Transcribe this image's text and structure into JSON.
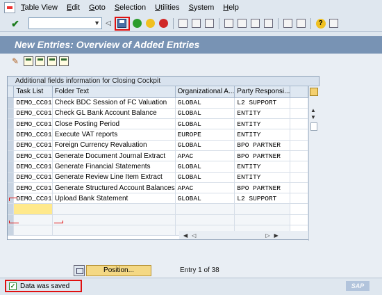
{
  "menu": {
    "items": [
      {
        "label": "Table View",
        "underline": "T",
        "rest": "able View"
      },
      {
        "label": "Edit",
        "underline": "E",
        "rest": "dit"
      },
      {
        "label": "Goto",
        "underline": "G",
        "rest": "oto"
      },
      {
        "label": "Selection",
        "underline": "S",
        "rest": "election"
      },
      {
        "label": "Utilities",
        "underline": "U",
        "rest": "tilities"
      },
      {
        "label": "System",
        "underline": "S",
        "rest": "ystem"
      },
      {
        "label": "Help",
        "underline": "H",
        "rest": "elp"
      }
    ]
  },
  "toolbar": {
    "command_field_value": "",
    "icons": [
      "enter-icon",
      "save-icon",
      "back-icon",
      "exit-icon",
      "cancel-icon",
      "print-icon",
      "find-icon",
      "find-next-icon",
      "first-page-icon",
      "previous-page-icon",
      "next-page-icon",
      "last-page-icon",
      "create-session-icon",
      "shortcut-icon",
      "help-icon",
      "layout-icon"
    ]
  },
  "title": "New Entries: Overview of Added Entries",
  "app_toolbar": {
    "icons": [
      "display-change-icon",
      "new-entries-icon",
      "copy-as-icon",
      "delete-icon",
      "undo-change-icon"
    ]
  },
  "table": {
    "title": "Additional fields information for Closing Cockpit",
    "columns": [
      "Task List",
      "Folder Text",
      "Organizational A...",
      "Party Responsi..."
    ],
    "rows": [
      [
        "DEMO_CC01",
        "Check BDC Session of FC Valuation",
        "GLOBAL",
        "L2 SUPPORT"
      ],
      [
        "DEMO_CC01",
        "Check GL Bank Account Balance",
        "GLOBAL",
        "ENTITY"
      ],
      [
        "DEMO_CC01",
        "Close Posting Period",
        "GLOBAL",
        "ENTITY"
      ],
      [
        "DEMO_CC01",
        "Execute VAT reports",
        "EUROPE",
        "ENTITY"
      ],
      [
        "DEMO_CC01",
        "Foreign Currency Revaluation",
        "GLOBAL",
        "BPO PARTNER"
      ],
      [
        "DEMO_CC01",
        "Generate Document Journal Extract",
        "APAC",
        "BPO PARTNER"
      ],
      [
        "DEMO_CC01",
        "Generate Financial Statements",
        "GLOBAL",
        "ENTITY"
      ],
      [
        "DEMO_CC01",
        "Generate Review Line Item Extract",
        "GLOBAL",
        "ENTITY"
      ],
      [
        "DEMO_CC01",
        "Generate Structured Account Balances",
        "APAC",
        "BPO PARTNER"
      ],
      [
        "DEMO_CC01",
        "Upload Bank Statement",
        "GLOBAL",
        "L2 SUPPORT"
      ]
    ],
    "empty_rows": 3
  },
  "position_button": {
    "label": "Position..."
  },
  "entry_info": "Entry 1 of 38",
  "status": {
    "message": "Data was saved",
    "type": "success"
  },
  "colors": {
    "title_bar": "#7893b4",
    "highlight": "#e01010",
    "input_cell": "#ffe98c"
  }
}
